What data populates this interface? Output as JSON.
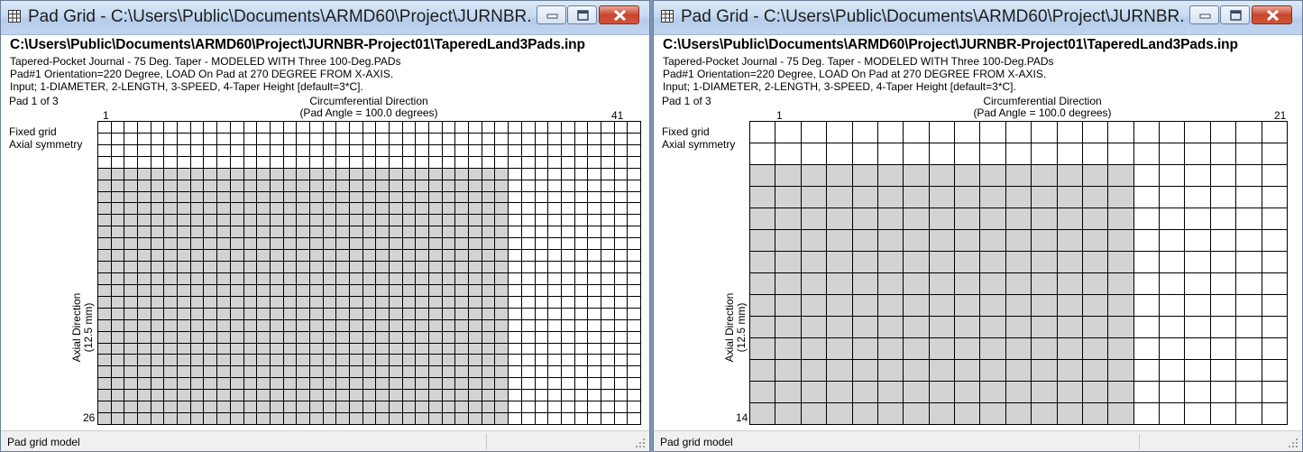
{
  "windows": [
    {
      "title": "Pad Grid - C:\\Users\\Public\\Documents\\ARMD60\\Project\\JURNBR...",
      "filepath": "C:\\Users\\Public\\Documents\\ARMD60\\Project\\JURNBR-Project01\\TaperedLand3Pads.inp",
      "info_lines": [
        "Tapered-Pocket Journal - 75 Deg. Taper - MODELED WITH Three 100-Deg.PADs",
        "Pad#1 Orientation=220 Degree, LOAD On Pad at 270 DEGREE FROM X-AXIS.",
        "Input; 1-DIAMETER, 2-LENGTH, 3-SPEED, 4-Taper Height [default=3*C]."
      ],
      "pad_label": "Pad 1 of 3",
      "circ_title": "Circumferential Direction",
      "circ_subtitle": "(Pad Angle = 100.0 degrees)",
      "col_start": "1",
      "col_end": "41",
      "row_end": "26",
      "grid_mode": "Fixed grid",
      "symmetry": "Axial symmetry",
      "axial_title": "Axial Direction",
      "axial_subtitle": "(12.5 mm)",
      "status": "Pad grid model",
      "grid": {
        "cols": 41,
        "rows": 26,
        "shaded_start_row": 4,
        "shaded_cols": 31,
        "shade_color": "#d3d3d3"
      }
    },
    {
      "title": "Pad Grid - C:\\Users\\Public\\Documents\\ARMD60\\Project\\JURNBR...",
      "filepath": "C:\\Users\\Public\\Documents\\ARMD60\\Project\\JURNBR-Project01\\TaperedLand3Pads.inp",
      "info_lines": [
        "Tapered-Pocket Journal - 75 Deg. Taper - MODELED WITH Three 100-Deg.PADs",
        "Pad#1 Orientation=220 Degree, LOAD On Pad at 270 DEGREE FROM X-AXIS.",
        "Input; 1-DIAMETER, 2-LENGTH, 3-SPEED, 4-Taper Height [default=3*C]."
      ],
      "pad_label": "Pad 1 of 3",
      "circ_title": "Circumferential Direction",
      "circ_subtitle": "(Pad Angle = 100.0 degrees)",
      "col_start": "1",
      "col_end": "21",
      "row_end": "14",
      "grid_mode": "Fixed grid",
      "symmetry": "Axial symmetry",
      "axial_title": "Axial Direction",
      "axial_subtitle": "(12.5 mm)",
      "status": "Pad grid model",
      "grid": {
        "cols": 21,
        "rows": 14,
        "shaded_start_row": 2,
        "shaded_cols": 15,
        "shade_color": "#d3d3d3"
      }
    }
  ]
}
